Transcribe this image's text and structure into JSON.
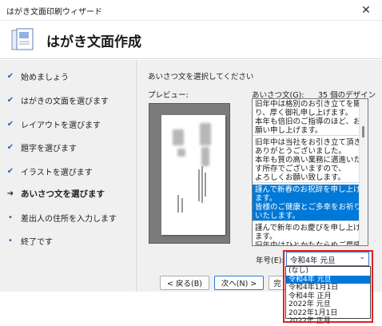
{
  "window": {
    "title": "はがき文面印刷ウィザード",
    "close_glyph": "✕"
  },
  "header": {
    "title": "はがき文面作成",
    "icon": "wizard-icon"
  },
  "steps": [
    {
      "label": "始めましょう",
      "mark": "✔"
    },
    {
      "label": "はがきの文面を選びます",
      "mark": "✔"
    },
    {
      "label": "レイアウトを選びます",
      "mark": "✔"
    },
    {
      "label": "題字を選びます",
      "mark": "✔"
    },
    {
      "label": "イラストを選びます",
      "mark": "✔"
    },
    {
      "label": "あいさつ文を選びます",
      "mark": "➔"
    },
    {
      "label": "差出人の住所を入力します",
      "mark": "•"
    },
    {
      "label": "終了です",
      "mark": "•"
    }
  ],
  "main": {
    "instruction": "あいさつ文を選択してください",
    "preview_label": "プレビュー:",
    "list_label": "あいさつ文(G):",
    "count_text": "35 個のデザイン",
    "greetings": [
      "旧年中は格別のお引き立てを賜\nり、厚く御礼申し上げます。\n本年も倍旧のご指導のほど、お\n願い申し上げます。",
      "旧年中は当社をお引き立て頂き\nありがとうございました。\n本年も質の高い業務に邁進いた\nす所存でございますので、\nよろしくお願い致します。",
      "謹んで新春のお祝辞を申し上げ\nます。\n皆様のご健康とご多幸をお祈り\nいたします。",
      "謹んで新年のお慶びを申し上げ\nます。\n旧年中はひとかたならぬご厚情\nを賜りまして素晴らしい年と"
    ],
    "era_label": "年号(E):",
    "era_selected": "令和4年 元旦",
    "era_options": [
      "(なし)",
      "令和4年 元旦",
      "令和4年1月1日",
      "令和4年 正月",
      "2022年 元旦",
      "2022年1月1日",
      "2022年 正月"
    ]
  },
  "buttons": {
    "back": "< 戻る(B)",
    "next": "次へ(N) >",
    "finish": "完"
  },
  "colors": {
    "selection": "#0078d7",
    "accent": "#2a5fb0",
    "highlight_frame": "#e02020"
  }
}
